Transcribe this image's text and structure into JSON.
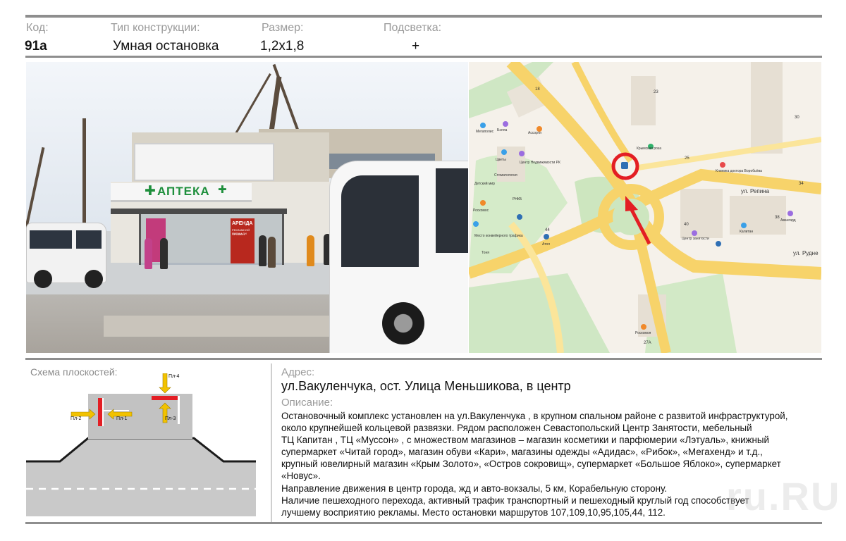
{
  "header": {
    "labels": {
      "code": "Код:",
      "type": "Тип конструкции:",
      "size": "Размер:",
      "light": "Подсветка:"
    },
    "values": {
      "code": "91а",
      "type": "Умная остановка",
      "size": "1,2х1,8",
      "light": "+"
    }
  },
  "photo": {
    "pharmacy_sign": "АПТЕКА",
    "shelter_ad_text": [
      "АРЕНДА",
      "РЕКЛАМНОЙ ПЛОЩАДИ",
      "ПРОСП..."
    ]
  },
  "map": {
    "streets": [
      "ул. Репина",
      "ул. Рудне"
    ],
    "pois": [
      "Мегаполис",
      "Бэлла",
      "Центр Недвижимости РК",
      "Цветы",
      "Детский мир",
      "Стоматология",
      "Ассорти",
      "РНКБ",
      "Роскомос",
      "Место конвейерного трафика",
      "Атол",
      "Тоня",
      "Крымская роза",
      "Клиника доктора Воробьёва",
      "Авангард",
      "Центр занятости",
      "Калитан",
      "Роскомоя"
    ],
    "house_numbers": [
      "18",
      "23",
      "30",
      "25",
      "34",
      "38",
      "40",
      "27А",
      "44"
    ],
    "marker_color": "#e31e24",
    "arrow_color": "#e31e24"
  },
  "schema": {
    "title": "Схема плоскостей:",
    "planes": [
      "Пл-4",
      "Пл-2",
      "Пл-1",
      "Пл-3"
    ],
    "plane_color": "#e31e24",
    "arrow_color": "#f2c200"
  },
  "address": {
    "label": "Адрес:",
    "text": "ул.Вакуленчука, ост. Улица Меньшикова, в центр"
  },
  "description": {
    "label": "Описание:",
    "paragraphs": [
      "Остановочный комплекс установлен на ул.Вакуленчука , в крупном спальном районе с развитой инфраструктурой,",
      " около крупнейшей кольцевой развязки. Рядом расположен Севастопольский Центр Занятости,  мебельный",
      "ТЦ Капитан , ТЦ «Муссон» , с множеством магазинов – магазин косметики и парфюмерии «Лэтуаль», книжный",
      "супермаркет «Читай город», магазин обуви «Кари», магазины одежды  «Адидас», «Рибок», «Мегахенд» и т.д.,",
      "крупный  ювелирный магазин «Крым Золото», «Остров сокровищ», супермаркет «Большое Яблоко», супермаркет",
      "«Новус».",
      "Направление движения в  центр города, жд и авто-вокзалы, 5 км, Корабельную сторону.",
      "Наличие пешеходного перехода, активный трафик транспортный и пешеходный круглый год  способствует",
      "лучшему восприятию рекламы. Место остановки маршрутов  107,109,10,95,105,44, 112."
    ]
  },
  "watermark": "ru.RU"
}
